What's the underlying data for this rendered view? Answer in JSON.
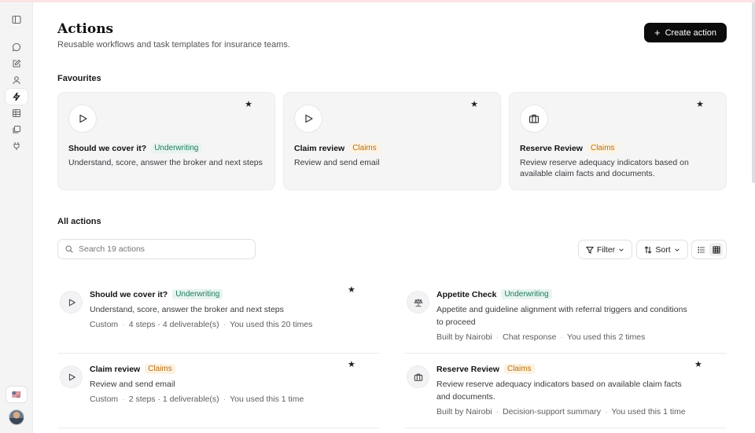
{
  "header": {
    "title": "Actions",
    "subtitle": "Reusable workflows and task templates for insurance teams.",
    "create_button": "Create action"
  },
  "sidebar": {
    "icons": [
      "panel-toggle-icon",
      "chat-icon",
      "edit-icon",
      "user-icon",
      "actions-icon",
      "table-icon",
      "files-icon",
      "plug-icon"
    ],
    "active": "actions-icon",
    "locale_flag": "🇺🇸"
  },
  "favourites": {
    "label": "Favourites",
    "cards": [
      {
        "icon": "play-icon",
        "title": "Should we cover it?",
        "tag": "Underwriting",
        "description": "Understand, score, answer the broker and next steps"
      },
      {
        "icon": "play-icon",
        "title": "Claim review",
        "tag": "Claims",
        "description": "Review and send email"
      },
      {
        "icon": "briefcase-icon",
        "title": "Reserve Review",
        "tag": "Claims",
        "description": "Review reserve adequacy indicators based on available claim facts and documents."
      }
    ]
  },
  "all_actions": {
    "label": "All actions",
    "search_placeholder": "Search 19 actions",
    "filter_label": "Filter",
    "sort_label": "Sort",
    "items": [
      {
        "icon": "play-icon",
        "title": "Should we cover it?",
        "tag": "Underwriting",
        "starred": true,
        "description": "Understand, score, answer the broker and next steps",
        "meta": [
          "Custom",
          "4 steps · 4 deliverable(s)",
          "You used this 20 times"
        ]
      },
      {
        "icon": "scale-icon",
        "title": "Appetite Check",
        "tag": "Underwriting",
        "starred": false,
        "description": "Appetite and guideline alignment with referral triggers and conditions to proceed",
        "meta": [
          "Built by Nairobi",
          "Chat response",
          "You used this 2 times"
        ]
      },
      {
        "icon": "play-icon",
        "title": "Claim review",
        "tag": "Claims",
        "starred": true,
        "description": "Review and send email",
        "meta": [
          "Custom",
          "2 steps · 1 deliverable(s)",
          "You used this 1 time"
        ]
      },
      {
        "icon": "briefcase-icon",
        "title": "Reserve Review",
        "tag": "Claims",
        "starred": true,
        "description": "Review reserve adequacy indicators based on available claim facts and documents.",
        "meta": [
          "Built by Nairobi",
          "Decision-support summary",
          "You used this 1 time"
        ]
      }
    ]
  },
  "colors": {
    "underwriting_tag_bg": "#e7f4ef",
    "underwriting_tag_fg": "#1f7a5c",
    "claims_tag_bg": "#fdf3e2",
    "claims_tag_fg": "#b86e0f",
    "primary_button": "#0c0c0d"
  }
}
